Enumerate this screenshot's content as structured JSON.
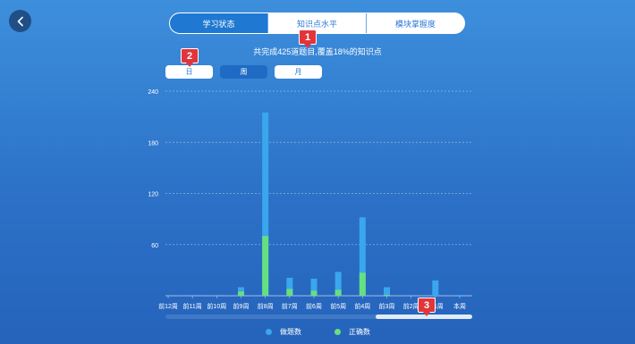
{
  "back_icon": "chevron-left-icon",
  "tabs": [
    {
      "label": "学习状态",
      "active": true
    },
    {
      "label": "知识点水平",
      "active": false
    },
    {
      "label": "模块掌握度",
      "active": false
    }
  ],
  "summary": "共完成425道题目,覆盖18%的知识点",
  "periods": [
    {
      "label": "日",
      "active": false
    },
    {
      "label": "周",
      "active": true
    },
    {
      "label": "月",
      "active": false
    }
  ],
  "badges": [
    "1",
    "2",
    "3"
  ],
  "chart_data": {
    "type": "bar",
    "stacked": "overlay",
    "categories": [
      "前12周",
      "前11周",
      "前10周",
      "前9周",
      "前8周",
      "前7周",
      "前6周",
      "前5周",
      "前4周",
      "前3周",
      "前2周",
      "前1周",
      "本周"
    ],
    "series": [
      {
        "name": "做题数",
        "color": "#3aa6ee",
        "values": [
          0,
          0,
          0,
          10,
          215,
          21,
          20,
          28,
          92,
          10,
          0,
          18,
          1
        ]
      },
      {
        "name": "正确数",
        "color": "#66e07e",
        "values": [
          0,
          0,
          0,
          5,
          70,
          8,
          6,
          7,
          27,
          1,
          0,
          0,
          0
        ]
      }
    ],
    "yticks": [
      60,
      120,
      180,
      240
    ],
    "ylim": [
      0,
      240
    ],
    "grid": true,
    "legend": "bottom-center"
  },
  "colors": {
    "accent": "#1f78d1",
    "badge": "#e2353a"
  }
}
